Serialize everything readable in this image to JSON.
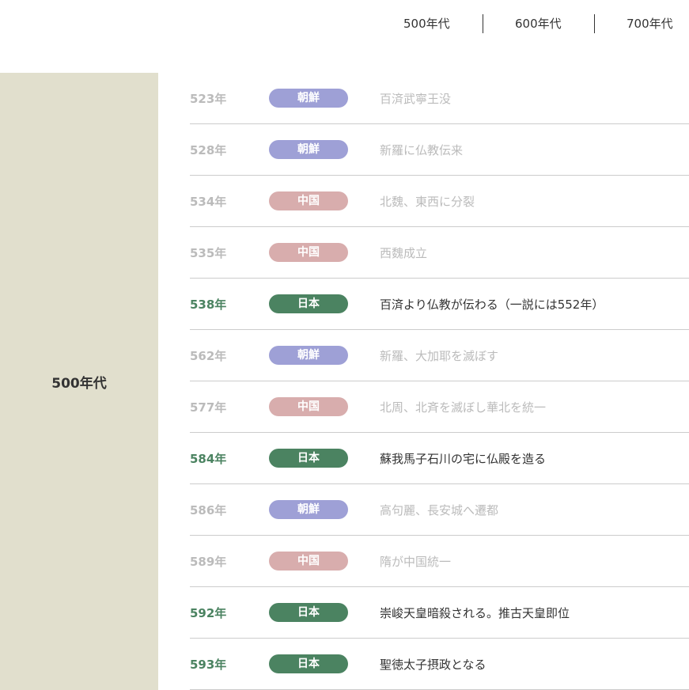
{
  "era_nav": [
    {
      "label": "500年代"
    },
    {
      "label": "600年代"
    },
    {
      "label": "700年代"
    }
  ],
  "sidebar": {
    "label": "500年代"
  },
  "colors": {
    "korea": "#9ea0d6",
    "china": "#d8adad",
    "japan": "#4b8361",
    "sidebar_bg": "#e1dfcd",
    "muted_text": "#bbbbbb",
    "active_text": "#333333"
  },
  "events": [
    {
      "year": "523年",
      "region": "朝鮮",
      "region_key": "korea",
      "text": "百済武寧王没",
      "highlight": false
    },
    {
      "year": "528年",
      "region": "朝鮮",
      "region_key": "korea",
      "text": "新羅に仏教伝来",
      "highlight": false
    },
    {
      "year": "534年",
      "region": "中国",
      "region_key": "china",
      "text": "北魏、東西に分裂",
      "highlight": false
    },
    {
      "year": "535年",
      "region": "中国",
      "region_key": "china",
      "text": "西魏成立",
      "highlight": false
    },
    {
      "year": "538年",
      "region": "日本",
      "region_key": "japan",
      "text": "百済より仏教が伝わる（一説には552年）",
      "highlight": true
    },
    {
      "year": "562年",
      "region": "朝鮮",
      "region_key": "korea",
      "text": "新羅、大加耶を滅ぼす",
      "highlight": false
    },
    {
      "year": "577年",
      "region": "中国",
      "region_key": "china",
      "text": "北周、北斉を滅ぼし華北を統一",
      "highlight": false
    },
    {
      "year": "584年",
      "region": "日本",
      "region_key": "japan",
      "text": "蘇我馬子石川の宅に仏殿を造る",
      "highlight": true
    },
    {
      "year": "586年",
      "region": "朝鮮",
      "region_key": "korea",
      "text": "高句麗、長安城へ遷都",
      "highlight": false
    },
    {
      "year": "589年",
      "region": "中国",
      "region_key": "china",
      "text": "隋が中国統一",
      "highlight": false
    },
    {
      "year": "592年",
      "region": "日本",
      "region_key": "japan",
      "text": "崇峻天皇暗殺される。推古天皇即位",
      "highlight": true
    },
    {
      "year": "593年",
      "region": "日本",
      "region_key": "japan",
      "text": "聖徳太子摂政となる",
      "highlight": true
    }
  ]
}
